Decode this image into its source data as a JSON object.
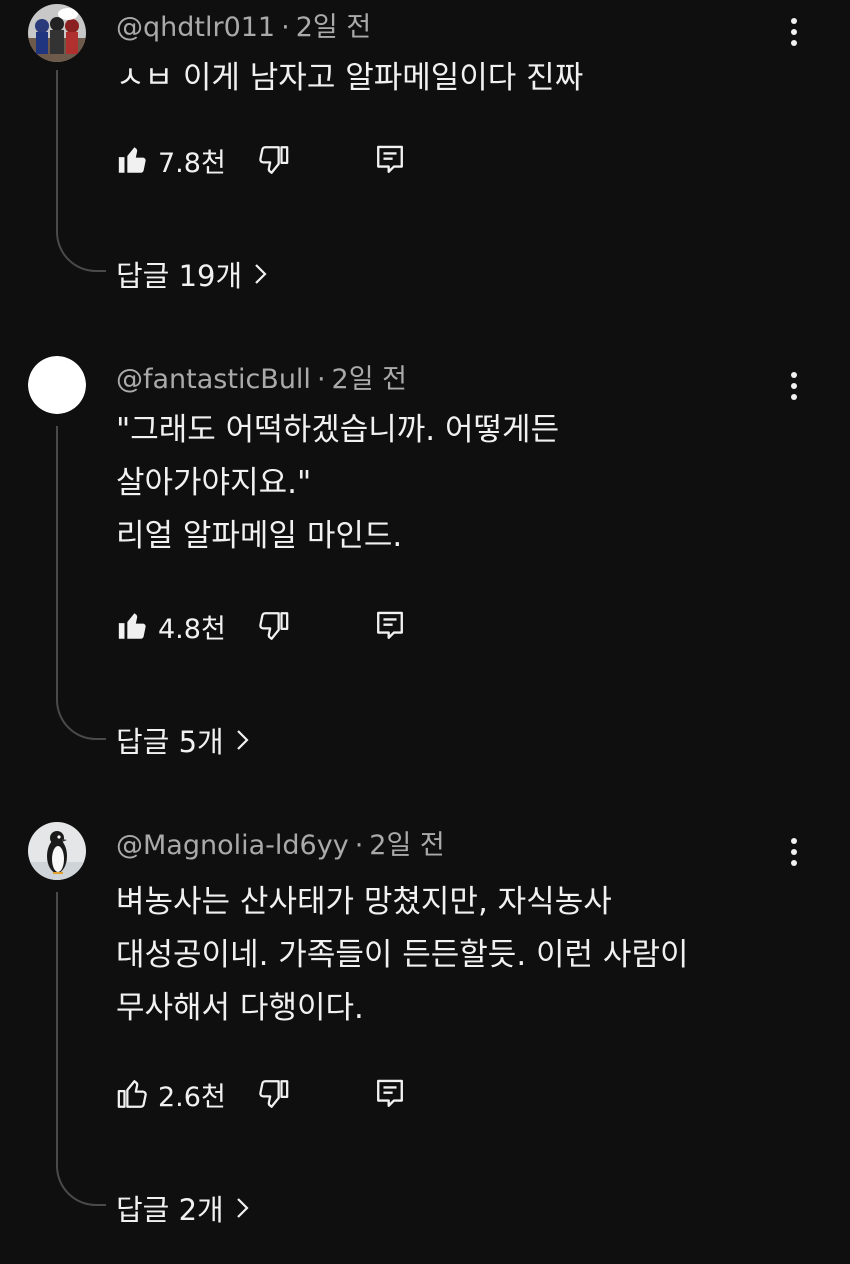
{
  "colors": {
    "background": "#0f0f0f",
    "text_primary": "#f1f1f1",
    "text_secondary": "#aaaaaa",
    "thread_line": "#4a4a4a"
  },
  "comments": [
    {
      "author": "@qhdtlr011",
      "separator": "·",
      "time": "2일 전",
      "avatar_icon": "comic-heroes-avatar",
      "lines": [
        "ㅅㅂ 이게 남자고 알파메일이다 진짜"
      ],
      "likes": "7.8천",
      "like_icon": "thumbs-up-filled-icon",
      "dislike_icon": "thumbs-down-icon",
      "reply_icon": "reply-icon",
      "replies_label": "답글 19개"
    },
    {
      "author": "@fantasticBull",
      "separator": "·",
      "time": "2일 전",
      "avatar_icon": "white-circle-avatar",
      "lines": [
        "\"그래도 어떡하겠습니까. 어떻게든",
        "살아가야지요.\"",
        "리얼 알파메일 마인드."
      ],
      "likes": "4.8천",
      "like_icon": "thumbs-up-filled-icon",
      "dislike_icon": "thumbs-down-icon",
      "reply_icon": "reply-icon",
      "replies_label": "답글 5개"
    },
    {
      "author": "@Magnolia-ld6yy",
      "separator": "·",
      "time": "2일 전",
      "avatar_icon": "penguin-avatar",
      "lines": [
        "벼농사는 산사태가 망쳤지만, 자식농사",
        "대성공이네. 가족들이 든든할듯. 이런 사람이",
        "무사해서 다행이다."
      ],
      "likes": "2.6천",
      "like_icon": "thumbs-up-outline-icon",
      "dislike_icon": "thumbs-down-icon",
      "reply_icon": "reply-icon",
      "replies_label": "답글 2개"
    }
  ]
}
